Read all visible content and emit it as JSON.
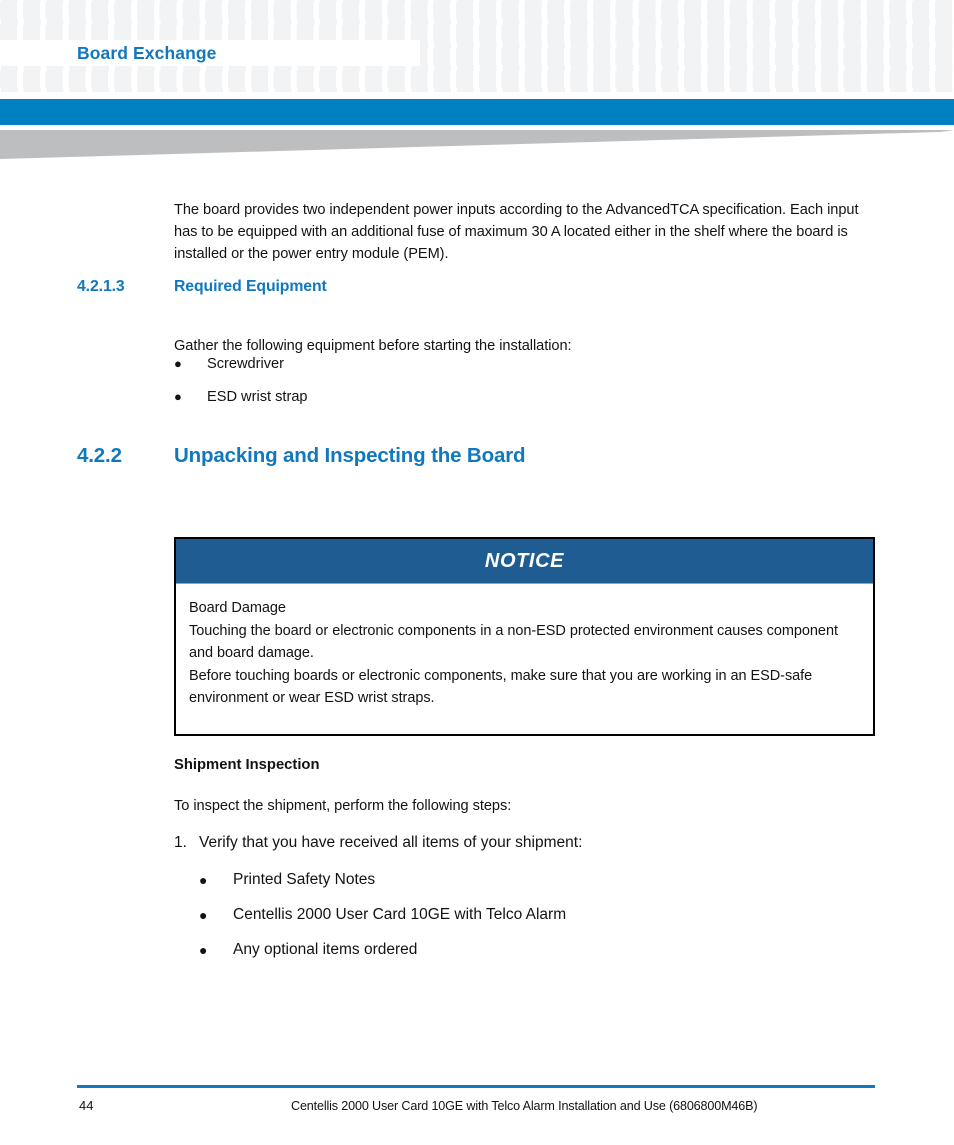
{
  "header": {
    "running_title": "Board Exchange"
  },
  "content": {
    "intro_paragraph": "The board provides two independent power inputs according to the AdvancedTCA specification. Each input has to be equipped with an additional fuse of maximum 30 A located either in the shelf where the board is installed or the power entry module (PEM).",
    "section_4213": {
      "number": "4.2.1.3",
      "title": "Required Equipment",
      "intro": "Gather the following equipment before starting the installation:",
      "bullets": [
        "Screwdriver",
        "ESD wrist strap"
      ]
    },
    "section_422": {
      "number": "4.2.2",
      "title": "Unpacking and Inspecting the Board"
    },
    "notice": {
      "label": "NOTICE",
      "lines": [
        "Board Damage",
        "Touching the board or electronic components in a non-ESD protected environment causes component and board damage.",
        "Before touching boards or electronic components, make sure that you are working in an ESD-safe environment or wear ESD wrist straps."
      ]
    },
    "shipment": {
      "heading": "Shipment Inspection",
      "intro": "To inspect the shipment, perform the following steps:",
      "steps": [
        {
          "index": "1.",
          "text": "Verify that you have received all items of your shipment:"
        }
      ],
      "bullets": [
        "Printed Safety Notes",
        "Centellis 2000 User Card 10GE with Telco Alarm",
        "Any optional items ordered"
      ]
    }
  },
  "footer": {
    "page_number": "44",
    "document_title": "Centellis 2000 User Card 10GE with Telco Alarm Installation and Use (6806800M46B)"
  },
  "colors": {
    "accent_blue": "#1178be",
    "bar_blue": "#0080c0",
    "notice_blue": "#1f5c91",
    "wedge_gray": "#bcbec0",
    "pattern_gray": "#f2f3f4"
  }
}
